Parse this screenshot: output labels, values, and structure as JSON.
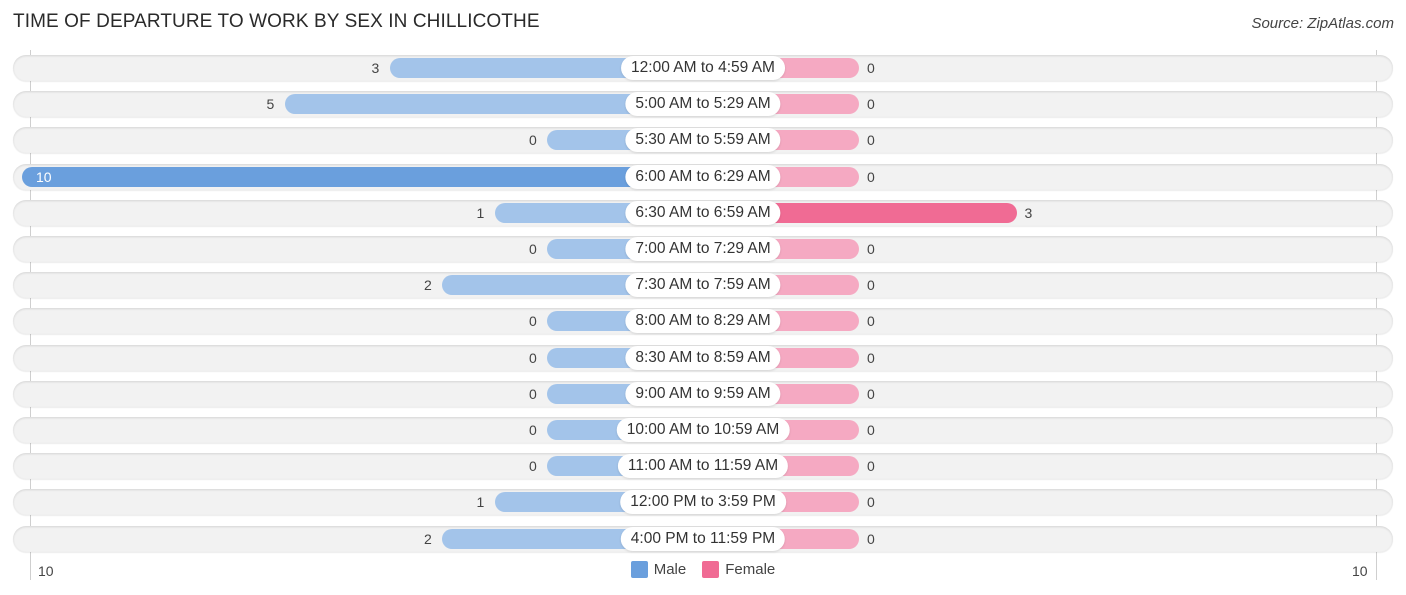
{
  "title": "TIME OF DEPARTURE TO WORK BY SEX IN CHILLICOTHE",
  "source": "Source: ZipAtlas.com",
  "colors": {
    "male_strong": "#6a9fdd",
    "male": "#a3c4ea",
    "female_strong": "#f06b94",
    "female": "#f5a9c2"
  },
  "chart_data": {
    "type": "bar",
    "orientation": "horizontal-diverging",
    "title": "TIME OF DEPARTURE TO WORK BY SEX IN CHILLICOTHE",
    "categories": [
      "12:00 AM to 4:59 AM",
      "5:00 AM to 5:29 AM",
      "5:30 AM to 5:59 AM",
      "6:00 AM to 6:29 AM",
      "6:30 AM to 6:59 AM",
      "7:00 AM to 7:29 AM",
      "7:30 AM to 7:59 AM",
      "8:00 AM to 8:29 AM",
      "8:30 AM to 8:59 AM",
      "9:00 AM to 9:59 AM",
      "10:00 AM to 10:59 AM",
      "11:00 AM to 11:59 AM",
      "12:00 PM to 3:59 PM",
      "4:00 PM to 11:59 PM"
    ],
    "series": [
      {
        "name": "Male",
        "values": [
          3,
          5,
          0,
          10,
          1,
          0,
          2,
          0,
          0,
          0,
          0,
          0,
          1,
          2
        ]
      },
      {
        "name": "Female",
        "values": [
          0,
          0,
          0,
          0,
          3,
          0,
          0,
          0,
          0,
          0,
          0,
          0,
          0,
          0
        ]
      }
    ],
    "xlim": [
      -10,
      10
    ],
    "axis_ticks": {
      "left": "10",
      "right": "10"
    },
    "legend": {
      "position": "bottom-center",
      "entries": [
        "Male",
        "Female"
      ]
    }
  }
}
